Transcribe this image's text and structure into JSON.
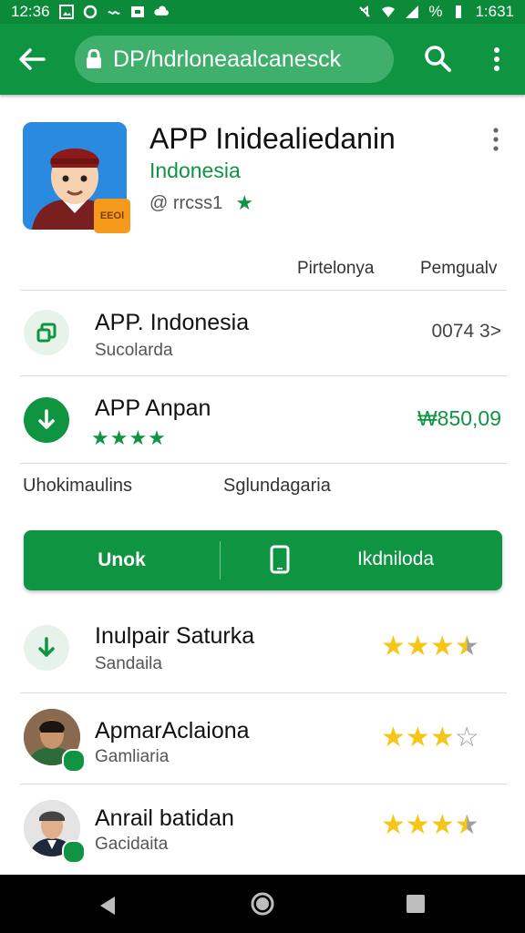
{
  "status_bar": {
    "time": "12:36",
    "right_text": "1:631"
  },
  "app_bar": {
    "url": "DP/hdrloneaalcanesck"
  },
  "app": {
    "title": "APP Inidealiedanin",
    "subtitle": "Indonesia",
    "meta": "@ rrcss1",
    "badge": "EEOl"
  },
  "header_labels": {
    "left": "Pirtelonya",
    "right": "Pemgualv"
  },
  "rows": [
    {
      "title": "APP. Indonesia",
      "subtitle": "Sucolarda",
      "right": "0074 3>"
    },
    {
      "title": "APP Anpan",
      "stars": "★★★★",
      "right": "₩850,09"
    }
  ],
  "tabs": {
    "left": "Uhokimaulins",
    "right": "Sglundagaria"
  },
  "action_bar": {
    "left_label": "Unok",
    "right_label": "Ikdniloda"
  },
  "list": [
    {
      "title": "Inulpair Saturka",
      "subtitle": "Sandaila",
      "rating": 3.5
    },
    {
      "title": "ApmarAclaiona",
      "subtitle": "Gamliaria",
      "rating": 3
    },
    {
      "title": "Anrail batidan",
      "subtitle": "Gacidaita",
      "rating": 3.5
    }
  ],
  "colors": {
    "primary": "#0f9442",
    "status": "#0b8a3a",
    "star": "#f5c518"
  }
}
